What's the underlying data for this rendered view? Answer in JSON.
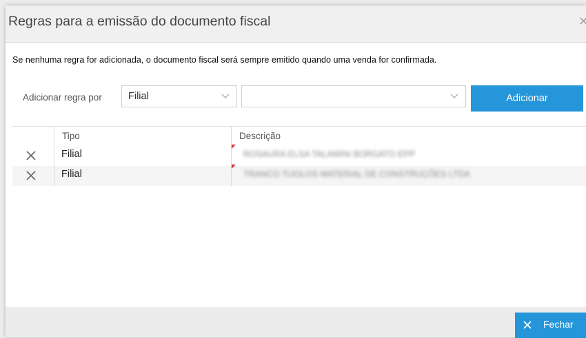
{
  "dialog": {
    "title": "Regras para a emissão do documento fiscal",
    "close_glyph": "×",
    "info": "Se nenhuma regra for adicionada, o documento fiscal será sempre emitido quando uma venda for confirmada."
  },
  "rule_form": {
    "label": "Adicionar regra por",
    "type_select": {
      "value": "Filial"
    },
    "value_select": {
      "value": ""
    },
    "add_button": "Adicionar"
  },
  "grid": {
    "headers": {
      "tipo": "Tipo",
      "descricao": "Descrição"
    },
    "rows": [
      {
        "tipo": "Filial",
        "descricao": "ROSAURA ELSA TALAMINI BORGATO EPP"
      },
      {
        "tipo": "Filial",
        "descricao": "TRANCO TIJOLOS MATERIAL DE CONSTRUÇÕES LTDA"
      }
    ]
  },
  "footer": {
    "close_button": "Fechar"
  },
  "colors": {
    "accent": "#2596d9",
    "header_bg": "#f0f0f0",
    "footer_bg": "#ececec",
    "dirty_flag": "#dd3333"
  }
}
